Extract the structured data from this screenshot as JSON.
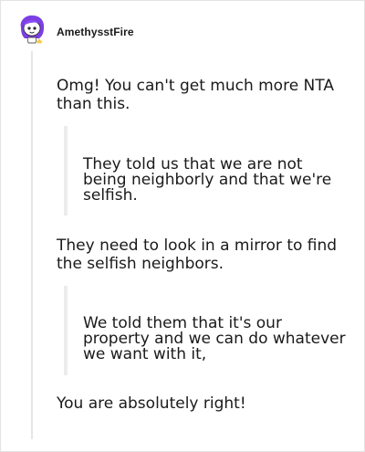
{
  "comment": {
    "username": "AmethysstFire",
    "paragraph_1": "Omg! You can't get much more NTA than this.",
    "quote_1": "They told us that we are not being neighborly and that we're selfish.",
    "paragraph_2": "They need to look in a mirror to find the selfish neighbors.",
    "quote_2": "We told them that it's our property and we can do whatever we want with it,",
    "paragraph_3": "You are absolutely right!"
  },
  "avatar": {
    "icon": "snoo-avatar-icon",
    "colors": {
      "hair": "#7b3fe4",
      "face": "#ffffff",
      "accent": "#f2c94c"
    }
  },
  "colors": {
    "text": "#1a1a1a",
    "thread_line": "#e6e6e6",
    "quote_bar": "#ececec",
    "border": "#e3e3e3"
  }
}
